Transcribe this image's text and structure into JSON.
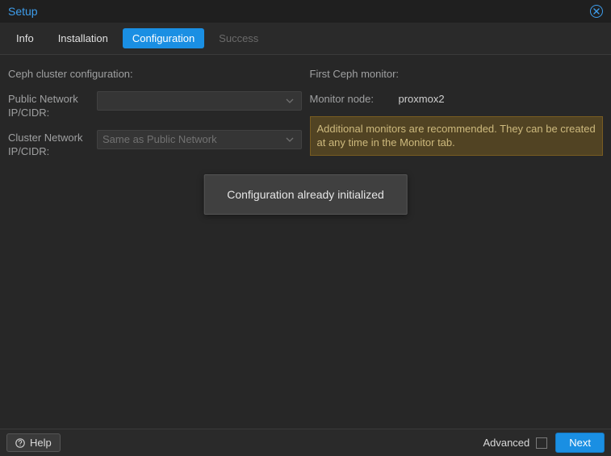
{
  "title": "Setup",
  "tabs": [
    {
      "label": "Info",
      "state": "normal"
    },
    {
      "label": "Installation",
      "state": "normal"
    },
    {
      "label": "Configuration",
      "state": "active"
    },
    {
      "label": "Success",
      "state": "disabled"
    }
  ],
  "left": {
    "heading": "Ceph cluster configuration:",
    "public_label": "Public Network IP/CIDR:",
    "public_value": "",
    "cluster_label": "Cluster Network IP/CIDR:",
    "cluster_placeholder": "Same as Public Network"
  },
  "right": {
    "heading": "First Ceph monitor:",
    "mon_label": "Monitor node:",
    "mon_value": "proxmox2",
    "warning": "Additional monitors are recommended. They can be created at any time in the Monitor tab."
  },
  "toast": "Configuration already initialized",
  "footer": {
    "help": "Help",
    "advanced": "Advanced",
    "next": "Next"
  }
}
